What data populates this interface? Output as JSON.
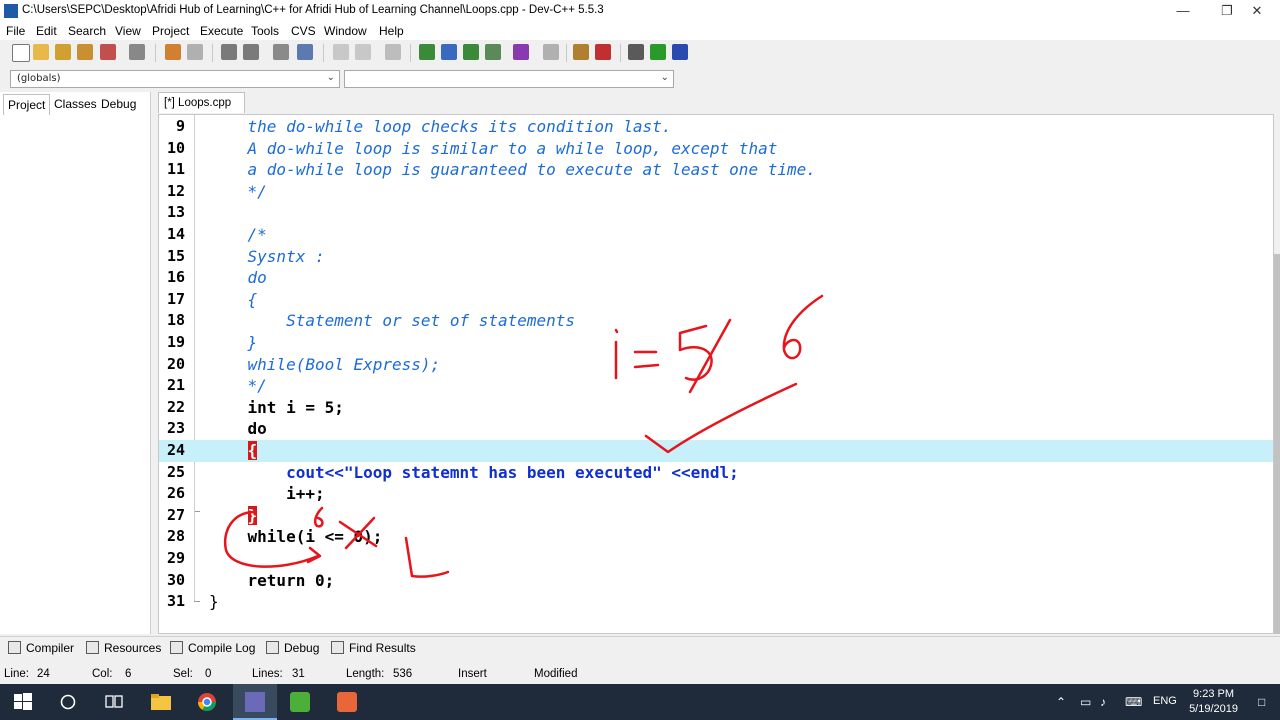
{
  "window": {
    "title": "C:\\Users\\SEPC\\Desktop\\Afridi Hub of Learning\\C++ for Afridi Hub of Learning Channel\\Loops.cpp - Dev-C++ 5.5.3"
  },
  "menu": [
    "File",
    "Edit",
    "Search",
    "View",
    "Project",
    "Execute",
    "Tools",
    "CVS",
    "Window",
    "Help"
  ],
  "combo": {
    "scope": "(globals)",
    "member": ""
  },
  "left_tabs": [
    "Project",
    "Classes",
    "Debug"
  ],
  "editor_tab": "[*] Loops.cpp",
  "lines": [
    {
      "n": "9",
      "text": "    the do-while loop checks its condition last."
    },
    {
      "n": "10",
      "text": "    A do-while loop is similar to a while loop, except that"
    },
    {
      "n": "11",
      "text": "    a do-while loop is guaranteed to execute at least one time."
    },
    {
      "n": "12",
      "text": "    */"
    },
    {
      "n": "13",
      "text": ""
    },
    {
      "n": "14",
      "text": "    /*"
    },
    {
      "n": "15",
      "text": "    Sysntx :"
    },
    {
      "n": "16",
      "text": "    do"
    },
    {
      "n": "17",
      "text": "    {"
    },
    {
      "n": "18",
      "text": "        Statement or set of statements"
    },
    {
      "n": "19",
      "text": "    }"
    },
    {
      "n": "20",
      "text": "    while(Bool Express);"
    },
    {
      "n": "21",
      "text": "    */"
    },
    {
      "n": "22",
      "text": "    int i = 5;"
    },
    {
      "n": "23",
      "text": "    do"
    },
    {
      "n": "24",
      "text": "    {"
    },
    {
      "n": "25",
      "text": "        cout<<\"Loop statemnt has been executed\" <<endl;"
    },
    {
      "n": "26",
      "text": "        i++;"
    },
    {
      "n": "27",
      "text": "    }"
    },
    {
      "n": "28",
      "text": "    while(i <= 0);"
    },
    {
      "n": "29",
      "text": ""
    },
    {
      "n": "30",
      "text": "    return 0;"
    },
    {
      "n": "31",
      "text": "}"
    }
  ],
  "bottom_tabs": [
    "Compiler",
    "Resources",
    "Compile Log",
    "Debug",
    "Find Results"
  ],
  "status": {
    "line_label": "Line:",
    "line": "24",
    "col_label": "Col:",
    "col": "6",
    "sel_label": "Sel:",
    "sel": "0",
    "lines_label": "Lines:",
    "lines": "31",
    "length_label": "Length:",
    "length": "536",
    "mode": "Insert",
    "modified": "Modified"
  },
  "taskbar": {
    "lang": "ENG",
    "time": "9:23 PM",
    "date": "5/19/2019"
  },
  "annotations": {
    "i_label": "i =",
    "crossed_value": "5",
    "new_value": "6",
    "line27_value": "6"
  },
  "colors": {
    "comment": "#1b6bd8",
    "active_line": "#c8f0fb",
    "brace_highlight": "#d61818",
    "ink": "#e8141b"
  }
}
